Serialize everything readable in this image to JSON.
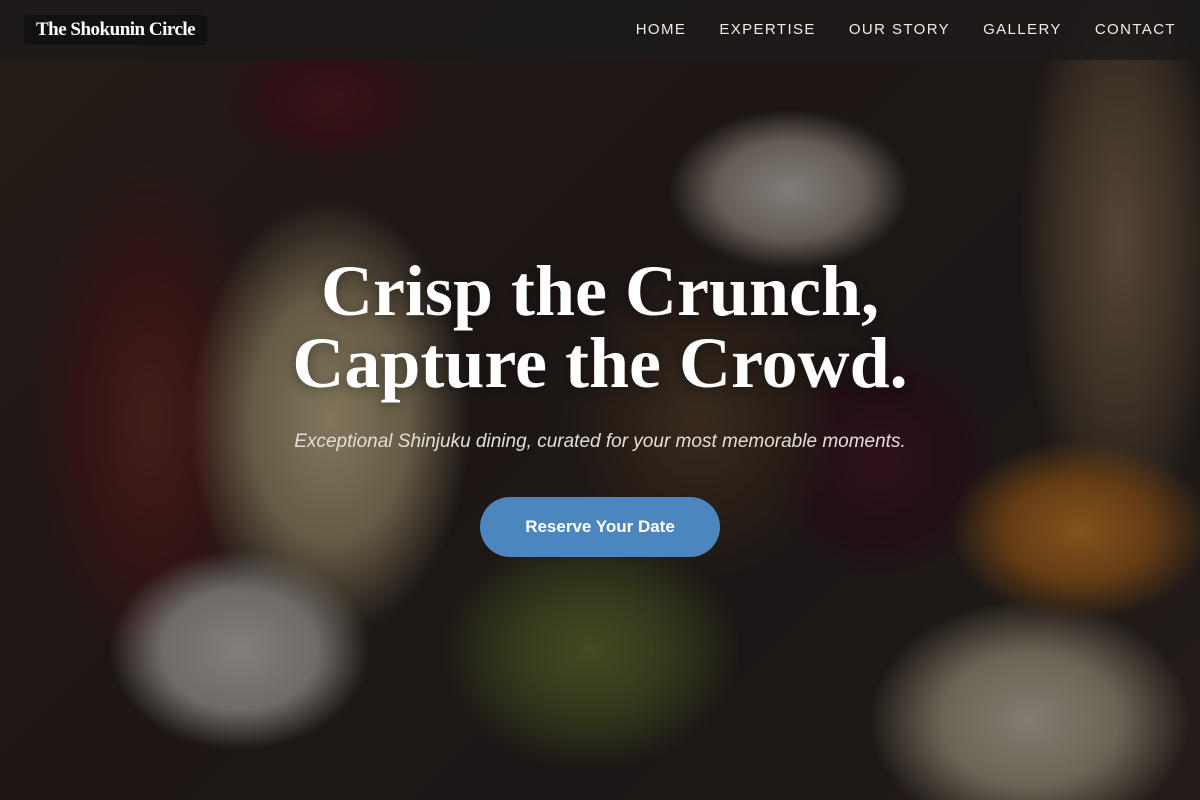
{
  "brand": {
    "name": "The Shokunin Circle"
  },
  "nav": {
    "items": [
      {
        "label": "HOME"
      },
      {
        "label": "EXPERTISE"
      },
      {
        "label": "OUR STORY"
      },
      {
        "label": "GALLERY"
      },
      {
        "label": "CONTACT"
      }
    ]
  },
  "hero": {
    "headline_line1": "Crisp the Crunch,",
    "headline_line2": "Capture the Crowd.",
    "subtitle": "Exceptional Shinjuku dining, curated for your most memorable moments.",
    "cta_label": "Reserve Your Date",
    "background_image": "charcuterie-board-photo"
  },
  "colors": {
    "accent": "#4b86be",
    "nav_bg": "#1c1a1a",
    "logo_bg": "#111111",
    "text_light": "#ffffff"
  }
}
